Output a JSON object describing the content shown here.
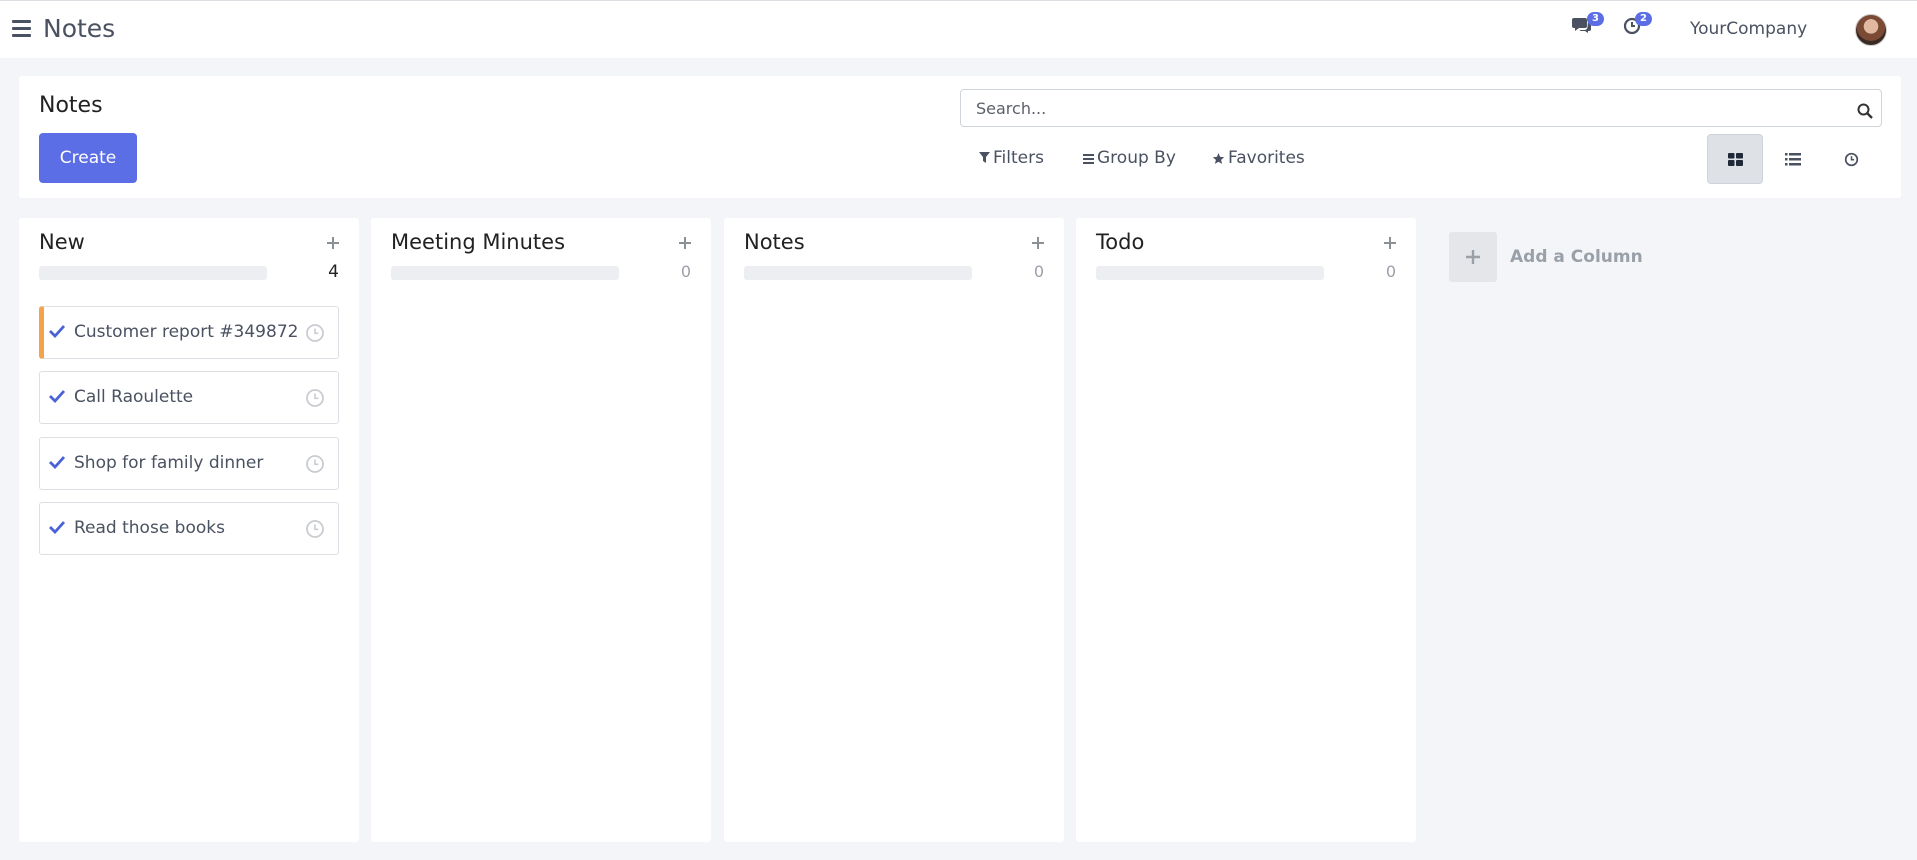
{
  "navbar": {
    "app_title": "Notes",
    "messages_count": "3",
    "activities_count": "2",
    "company": "YourCompany"
  },
  "control_panel": {
    "breadcrumb": "Notes",
    "create_label": "Create",
    "search_placeholder": "Search...",
    "filters_label": "Filters",
    "group_by_label": "Group By",
    "favorites_label": "Favorites"
  },
  "kanban": {
    "columns": [
      {
        "title": "New",
        "count": "4",
        "cards": [
          {
            "title": "Customer report #349872"
          },
          {
            "title": "Call Raoulette"
          },
          {
            "title": "Shop for family dinner"
          },
          {
            "title": "Read those books"
          }
        ]
      },
      {
        "title": "Meeting Minutes",
        "count": "0",
        "cards": []
      },
      {
        "title": "Notes",
        "count": "0",
        "cards": []
      },
      {
        "title": "Todo",
        "count": "0",
        "cards": []
      }
    ],
    "add_column_label": "Add a Column"
  },
  "colors": {
    "primary": "#5b6ee6",
    "accent_card": "#f4a24b",
    "background": "#f4f5f8"
  },
  "icons": [
    "menu-icon",
    "chat-icon",
    "activity-clock-icon",
    "search-icon",
    "filter-icon",
    "group-by-icon",
    "star-icon",
    "kanban-view-icon",
    "list-view-icon",
    "activity-view-icon",
    "check-icon",
    "clock-icon",
    "plus-icon"
  ]
}
